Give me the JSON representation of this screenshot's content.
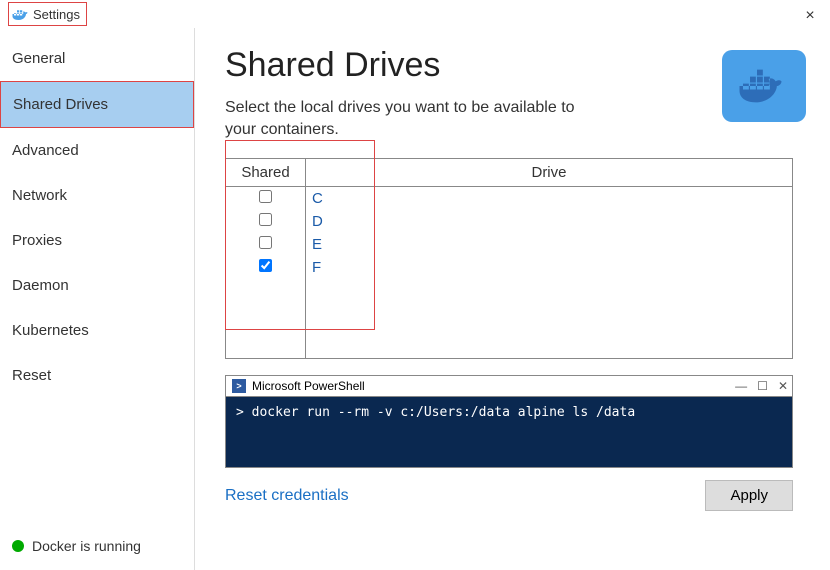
{
  "window": {
    "title": "Settings",
    "close_label": "×"
  },
  "sidebar": {
    "items": [
      {
        "label": "General",
        "active": false
      },
      {
        "label": "Shared Drives",
        "active": true
      },
      {
        "label": "Advanced",
        "active": false
      },
      {
        "label": "Network",
        "active": false
      },
      {
        "label": "Proxies",
        "active": false
      },
      {
        "label": "Daemon",
        "active": false
      },
      {
        "label": "Kubernetes",
        "active": false
      },
      {
        "label": "Reset",
        "active": false
      }
    ],
    "status": {
      "label": "Docker is running",
      "color": "#00aa00"
    }
  },
  "main": {
    "title": "Shared Drives",
    "description": "Select the local drives you want to be available to your containers.",
    "table": {
      "headers": {
        "shared": "Shared",
        "drive": "Drive"
      },
      "rows": [
        {
          "checked": false,
          "drive": "C"
        },
        {
          "checked": false,
          "drive": "D"
        },
        {
          "checked": false,
          "drive": "E"
        },
        {
          "checked": true,
          "drive": "F"
        }
      ]
    },
    "powershell": {
      "title": "Microsoft PowerShell",
      "command": ">  docker run --rm -v c:/Users:/data alpine ls /data"
    },
    "reset_link": "Reset credentials",
    "apply_label": "Apply"
  }
}
